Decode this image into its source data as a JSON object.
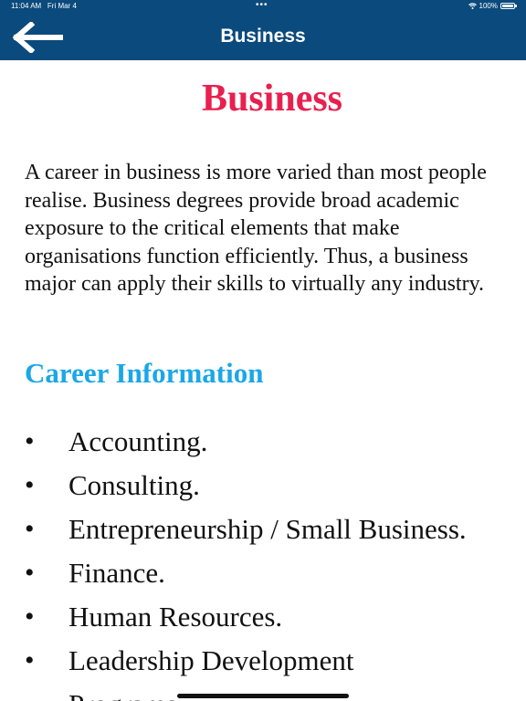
{
  "status_bar": {
    "time": "11:04 AM",
    "date": "Fri Mar 4",
    "dots": "•••",
    "battery": "100%"
  },
  "nav": {
    "title": "Business",
    "back_icon": "arrow-left-icon"
  },
  "page": {
    "title": "Business",
    "intro": "A career in business is more varied than most people realise. Business degrees provide broad academic exposure to the critical elements that make organisations function efficiently. Thus, a business major can apply their skills to virtually any industry.",
    "section_heading": "Career Information",
    "career_items": [
      "Accounting.",
      "Consulting.",
      "Entrepreneurship / Small Business.",
      "Finance.",
      "Human Resources.",
      "Leadership Development Programs."
    ],
    "bullet": "•"
  },
  "colors": {
    "nav_background": "#0b4a7c",
    "title": "#e8204f",
    "section_heading": "#1aa7e8",
    "body_text": "#111111"
  }
}
